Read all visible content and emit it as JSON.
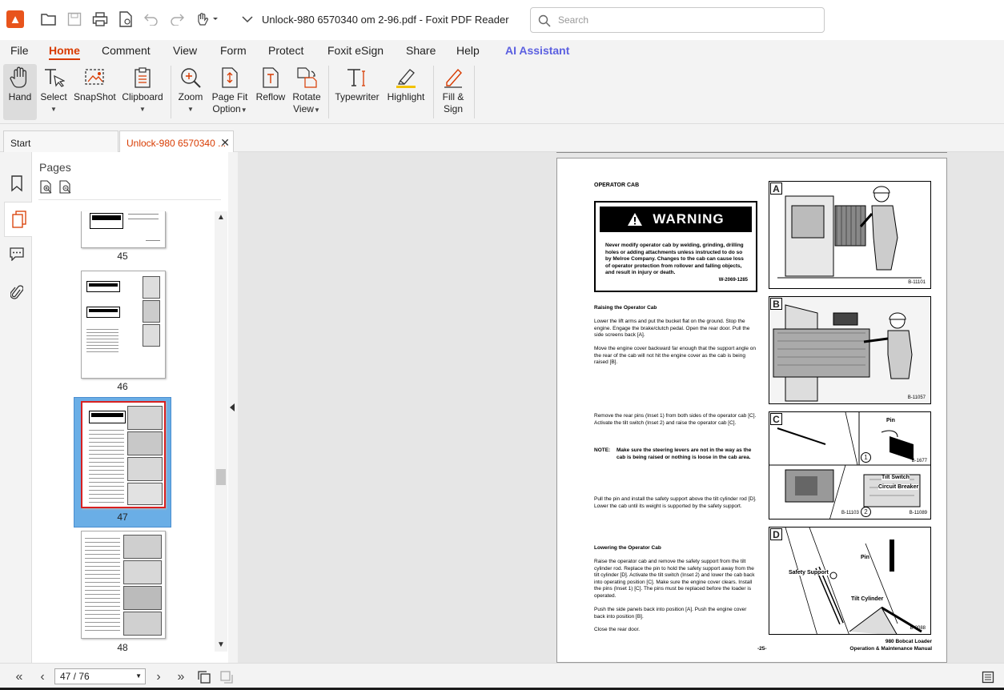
{
  "window": {
    "title": "Unlock-980 6570340 om 2-96.pdf - Foxit PDF Reader",
    "search_placeholder": "Search"
  },
  "menu": {
    "items": [
      "File",
      "Home",
      "Comment",
      "View",
      "Form",
      "Protect",
      "Foxit eSign",
      "Share",
      "Help",
      "AI Assistant"
    ],
    "active": "Home"
  },
  "ribbon": {
    "hand": "Hand",
    "select": "Select",
    "snapshot": "SnapShot",
    "clipboard": "Clipboard",
    "zoom": "Zoom",
    "page_fit_1": "Page Fit",
    "page_fit_2": "Option",
    "reflow": "Reflow",
    "rotate_1": "Rotate",
    "rotate_2": "View",
    "typewriter": "Typewriter",
    "highlight": "Highlight",
    "fill_1": "Fill &",
    "fill_2": "Sign"
  },
  "tabs": {
    "start": "Start",
    "document": "Unlock-980 6570340 ..."
  },
  "pages_panel": {
    "title": "Pages",
    "thumbnails": [
      "45",
      "46",
      "47",
      "48"
    ],
    "selected": "47"
  },
  "status": {
    "page_indicator": "47 / 76"
  },
  "colors": {
    "accent": "#d83b01",
    "ai": "#5b5fe0",
    "selected_thumb": "#6aaee6"
  },
  "document": {
    "section_title": "OPERATOR CAB",
    "warning_header": "WARNING",
    "warning_text": "Never modify operator cab by welding, grinding, drilling holes or adding attachments unless instructed to do so by Melroe Company. Changes to the cab can cause loss of operator protection from rollover and falling objects, and result in injury or death.",
    "warning_code": "W-2069-1285",
    "raising_title": "Raising the Operator Cab",
    "raising_p1": "Lower the lift arms and put the bucket flat on the ground. Stop the engine. Engage the brake/clutch pedal. Open the rear door. Pull the side screens back [A].",
    "raising_p2": "Move the engine cover backward far enough that the support angle on the rear of the cab will not hit the engine cover as the cab is being raised [B].",
    "remove_p": "Remove the rear pins (Inset 1) from both sides of the operator cab [C]. Activate the tilt switch (Inset 2) and raise the operator cab [C].",
    "note_label": "NOTE:",
    "note_text": "Make sure the steering levers are not in the way as the cab is being raised or nothing is loose in the cab area.",
    "pull_p": "Pull the pin and install the safety support above the tilt cylinder rod [D]. Lower the cab until its weight is supported by the safety support.",
    "lowering_title": "Lowering the Operator Cab",
    "lowering_p1": "Raise the operator cab and remove the safety support from the tilt cylinder rod. Replace the pin to hold the safety support away from the tilt cylinder [D]. Activate the tilt switch (Inset 2) and lower the cab back into operating position [C]. Make sure the engine cover clears. Install the pins (Inset 1) [C]. The pins must be replaced before the loader is operated.",
    "lowering_p2": "Push the side panels back into position [A]. Push the engine cover back into position [B].",
    "lowering_p3": "Close the rear door.",
    "page_number": "-25-",
    "footer_1": "980 Bobcat Loader",
    "footer_2": "Operation & Maintenance Manual",
    "figures": {
      "a_letter": "A",
      "a_code": "B-11101",
      "b_letter": "B",
      "b_code": "B-11057",
      "c_letter": "C",
      "c_pin": "Pin",
      "c_code1": "B-1677",
      "c_tilt": "Tilt Switch",
      "c_breaker": "Circuit Breaker",
      "c_code2": "B-11103",
      "c_code3": "B-11089",
      "c_inset1": "1",
      "c_inset2": "2",
      "d_letter": "D",
      "d_pin": "Pin",
      "d_support": "Safety Support",
      "d_cyl": "Tilt Cylinder",
      "d_code": "B-2088"
    }
  }
}
